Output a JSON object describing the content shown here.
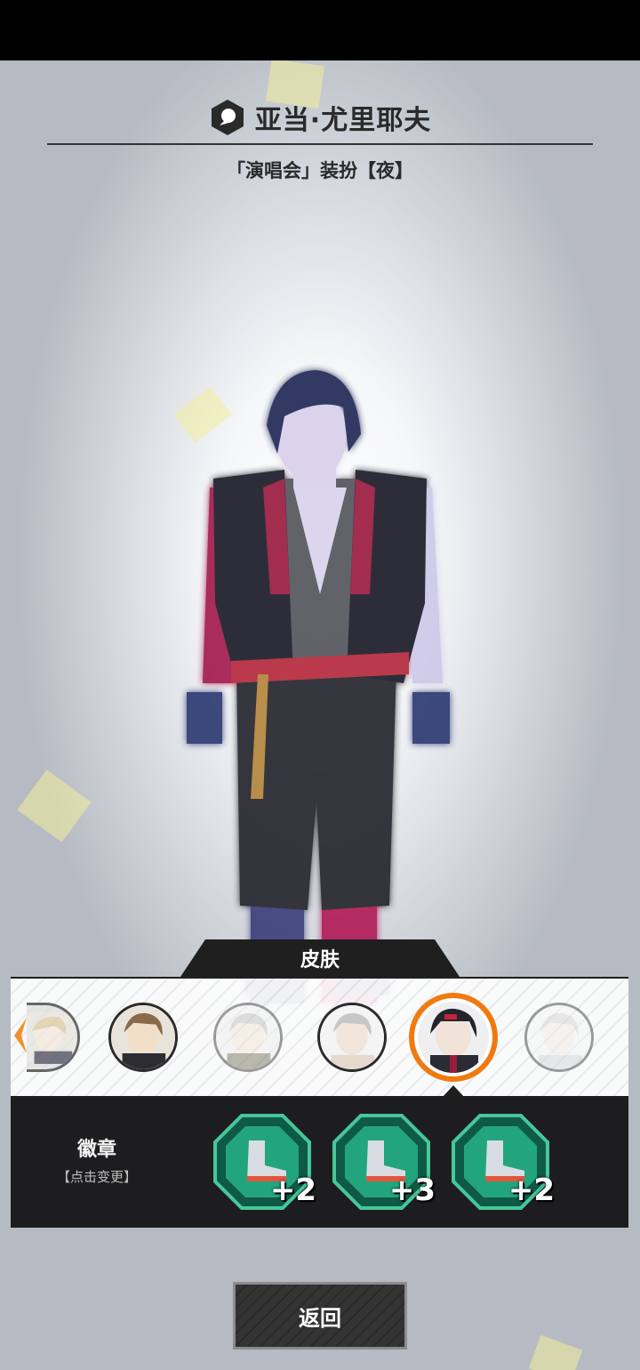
{
  "header": {
    "character_name": "亚当·尤里耶夫",
    "outfit_name": "「演唱会」装扮【夜】"
  },
  "skin_section": {
    "tab_label": "皮肤",
    "avatars": [
      {
        "id": "skin-1",
        "state": "partial"
      },
      {
        "id": "skin-2",
        "state": "normal"
      },
      {
        "id": "skin-3",
        "state": "faded"
      },
      {
        "id": "skin-4",
        "state": "normal"
      },
      {
        "id": "skin-5",
        "state": "selected"
      },
      {
        "id": "skin-6",
        "state": "faded"
      }
    ]
  },
  "badge_section": {
    "label": "徽章",
    "hint": "【点击变更】",
    "badges": [
      {
        "icon": "boot-icon",
        "level": "+2"
      },
      {
        "icon": "boot-icon",
        "level": "+3"
      },
      {
        "icon": "boot-icon",
        "level": "+2"
      }
    ]
  },
  "footer": {
    "return_label": "返回"
  },
  "colors": {
    "selected_ring": "#f07a10",
    "panel_dark": "#1d1d1f",
    "badge_green": "#1ea57a"
  }
}
